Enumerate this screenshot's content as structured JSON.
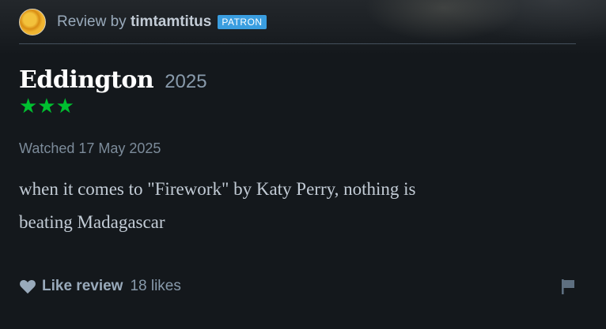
{
  "header": {
    "review_by_prefix": "Review by",
    "username": "timtamtitus",
    "badge": "PATRON"
  },
  "film": {
    "title": "Eddington",
    "year": "2025",
    "rating_stars": 3,
    "stars_text": "★★★"
  },
  "review": {
    "watched": "Watched 17 May 2025",
    "body_line1": "when it comes to \"Firework\" by Katy Perry, nothing is",
    "body_line2": "beating Madagascar"
  },
  "footer": {
    "like_label": "Like review",
    "likes_count": "18 likes"
  },
  "icons": {
    "heart": "heart-icon",
    "flag": "flag-icon"
  },
  "colors": {
    "background": "#14181c",
    "star": "#00c030",
    "badge": "#3a9ee0"
  }
}
